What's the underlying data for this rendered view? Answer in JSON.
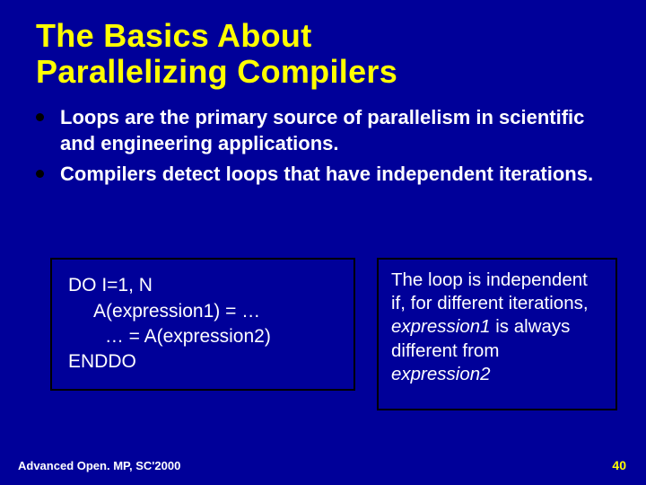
{
  "title_line1": "The Basics About",
  "title_line2": "Parallelizing Compilers",
  "bullets": [
    "Loops are the primary source of parallelism in scientific and engineering applications.",
    "Compilers detect loops that have independent iterations."
  ],
  "code": {
    "l1": "DO I=1, N",
    "l2": "     A(expression1) = …",
    "l3": "       … = A(expression2)",
    "l4": "ENDDO"
  },
  "explain": {
    "p1": "The loop is independent if, for different iterations, ",
    "e1": "expression1",
    "p2": " is always different from ",
    "e2": "expression2"
  },
  "footer_left": "Advanced Open. MP, SC'2000",
  "footer_right": "40"
}
